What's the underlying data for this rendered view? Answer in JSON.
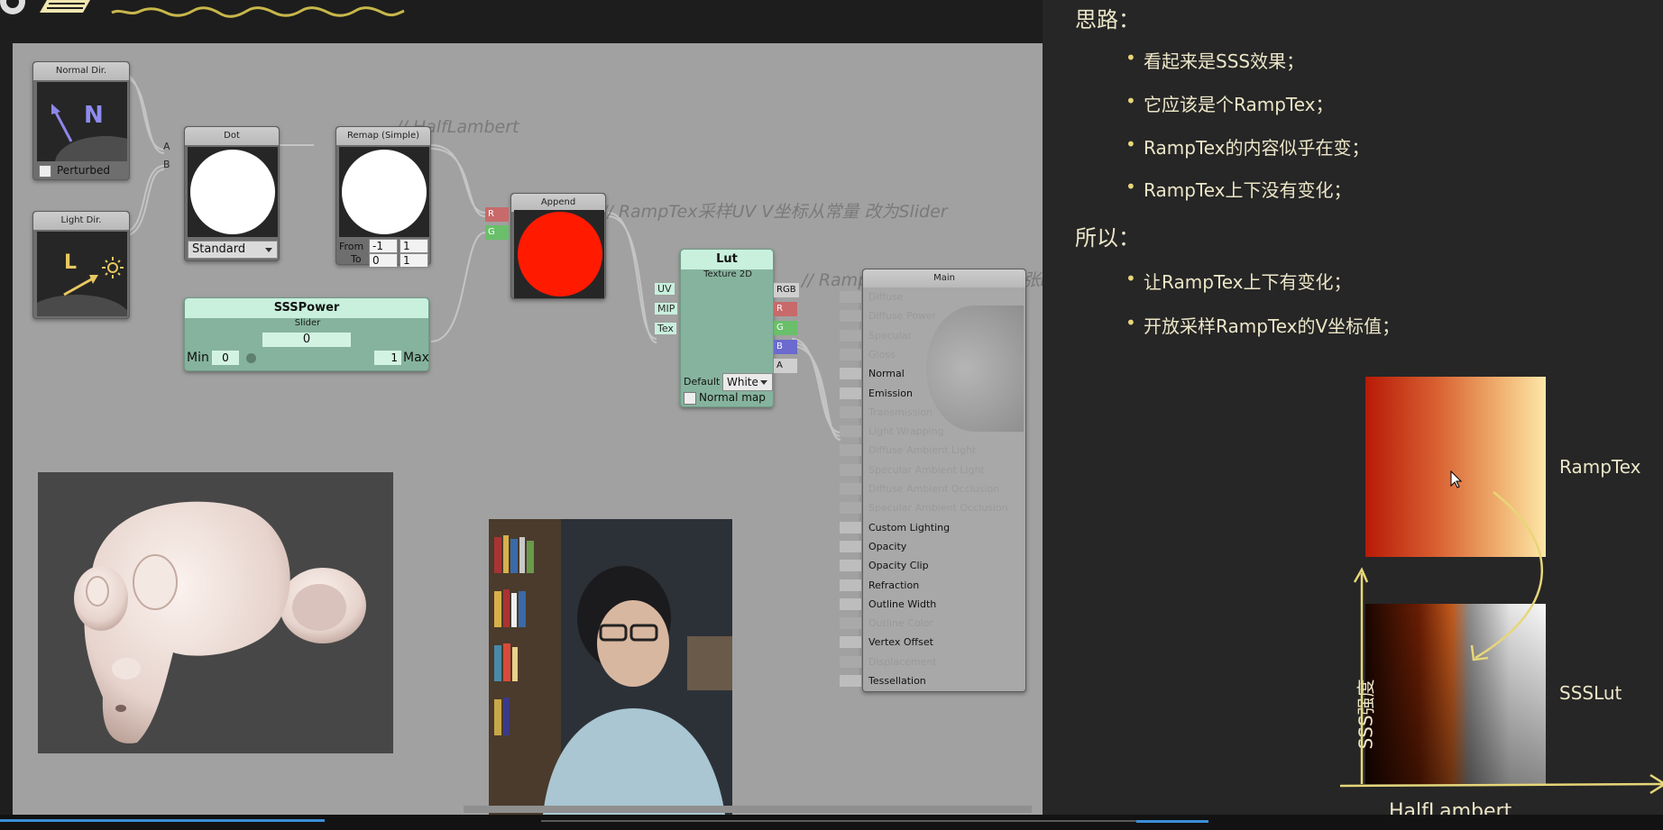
{
  "canvas": {
    "comments": {
      "halflambert": "// HalfLambert",
      "ramptex_uv": "// RampTex采样UV V坐标从常量 改为Slider",
      "lut_gradient": "// RampTex上下渐变一致 这张Lut上下也有渐变"
    },
    "nodes": {
      "normal_dir": {
        "title": "Normal Dir.",
        "glyph": "N",
        "checkbox_label": "Perturbed"
      },
      "light_dir": {
        "title": "Light Dir.",
        "glyph": "L",
        "icon": "sun-icon"
      },
      "dot": {
        "title": "Dot",
        "port_a": "A",
        "port_b": "B",
        "mode": "Standard"
      },
      "remap": {
        "title": "Remap (Simple)",
        "from_label": "From",
        "to_label": "To",
        "from_min": "-1",
        "from_max": "1",
        "to_min": "0",
        "to_max": "1"
      },
      "append": {
        "title": "Append",
        "port_r": "R",
        "port_g": "G",
        "preview_color": "#ff1a00"
      },
      "ssspower": {
        "title": "SSSPower",
        "subtitle": "Slider",
        "value": "0",
        "min_label": "Min",
        "min_value": "0",
        "max_label": "Max",
        "max_value": "1"
      },
      "lut": {
        "title": "Lut",
        "subtitle": "Texture 2D",
        "inputs": [
          "UV",
          "MIP",
          "Tex"
        ],
        "outputs": [
          "RGB",
          "R",
          "G",
          "B",
          "A"
        ],
        "default_label": "Default",
        "default_value": "White",
        "normal_map_label": "Normal map"
      },
      "main": {
        "title": "Main",
        "rows": [
          {
            "label": "Diffuse",
            "on": false
          },
          {
            "label": "Diffuse Power",
            "on": false
          },
          {
            "label": "Specular",
            "on": false
          },
          {
            "label": "Gloss",
            "on": false
          },
          {
            "label": "Normal",
            "on": true
          },
          {
            "label": "Emission",
            "on": true
          },
          {
            "label": "Transmission",
            "on": false
          },
          {
            "label": "Light Wrapping",
            "on": false
          },
          {
            "label": "Diffuse Ambient Light",
            "on": false
          },
          {
            "label": "Specular Ambient Light",
            "on": false
          },
          {
            "label": "Diffuse Ambient Occlusion",
            "on": false
          },
          {
            "label": "Specular Ambient Occlusion",
            "on": false
          },
          {
            "label": "Custom Lighting",
            "on": true
          },
          {
            "label": "Opacity",
            "on": true
          },
          {
            "label": "Opacity Clip",
            "on": true
          },
          {
            "label": "Refraction",
            "on": true
          },
          {
            "label": "Outline Width",
            "on": true
          },
          {
            "label": "Outline Color",
            "on": false
          },
          {
            "label": "Vertex Offset",
            "on": true
          },
          {
            "label": "Displacement",
            "on": false
          },
          {
            "label": "Tessellation",
            "on": true
          }
        ]
      }
    }
  },
  "slide": {
    "heading1": "思路：",
    "points1": [
      "看起来是SSS效果；",
      "它应该是个RampTex；",
      "RampTex的内容似乎在变；",
      "RampTex上下没有变化；"
    ],
    "heading2": "所以：",
    "points2": [
      "让RampTex上下有变化；",
      "开放采样RampTex的V坐标值；"
    ],
    "label_ramptex": "RampTex",
    "label_ssslut": "SSSLut",
    "axis_y": "SSS强度",
    "axis_x": "HalfLambert",
    "bullet": "•"
  },
  "colors": {
    "accent": "#e7d679",
    "canvas": "#a1a1a1",
    "green_node": "#86b39e"
  }
}
